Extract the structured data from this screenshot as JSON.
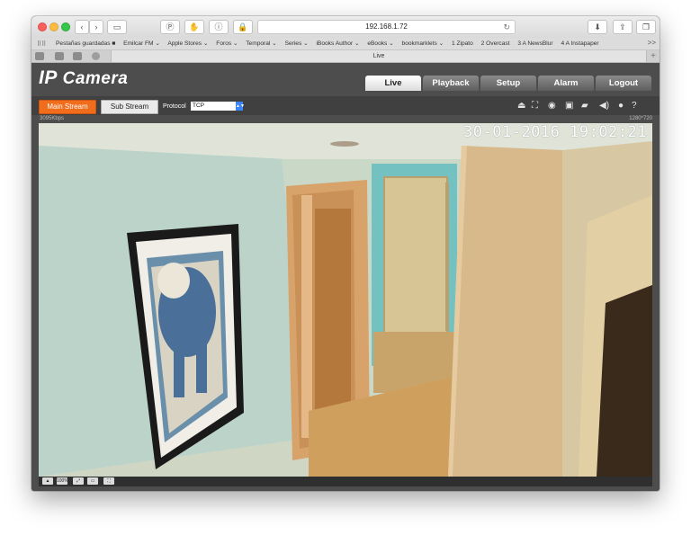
{
  "browser": {
    "url": "192.168.1.72",
    "tab_title": "Live",
    "reload_icon": "reload-icon",
    "bookmarks": [
      "Pestañas guardadas ■",
      "Emilcar FM ⌄",
      "Apple Stores ⌄",
      "Foros ⌄",
      "Temporal ⌄",
      "Series ⌄",
      "iBooks Author ⌄",
      "eBooks ⌄",
      "bookmarklets ⌄",
      "1 Zipato",
      "2 Overcast",
      "3 A NewsBlur",
      "4 A Instapaper"
    ],
    "bookmarks_more": ">>",
    "add_tab": "+"
  },
  "app": {
    "logo_ip": "IP",
    "logo_text": "Camera",
    "nav": {
      "live": "Live",
      "playback": "Playback",
      "setup": "Setup",
      "alarm": "Alarm",
      "logout": "Logout"
    },
    "toolbar": {
      "main_stream": "Main Stream",
      "sub_stream": "Sub Stream",
      "protocol_label": "Protocol",
      "protocol_value": "TCP"
    }
  },
  "video": {
    "bitrate": "3095Kbps",
    "resolution": "1280*720",
    "timestamp": "30-01-2016 19:02:21"
  },
  "bottom_controls": {
    "zoom_label": "100%"
  },
  "colors": {
    "accent_orange": "#f26d1b",
    "page_bg": "#4d4d4d",
    "active_tab": "#ffffff"
  }
}
